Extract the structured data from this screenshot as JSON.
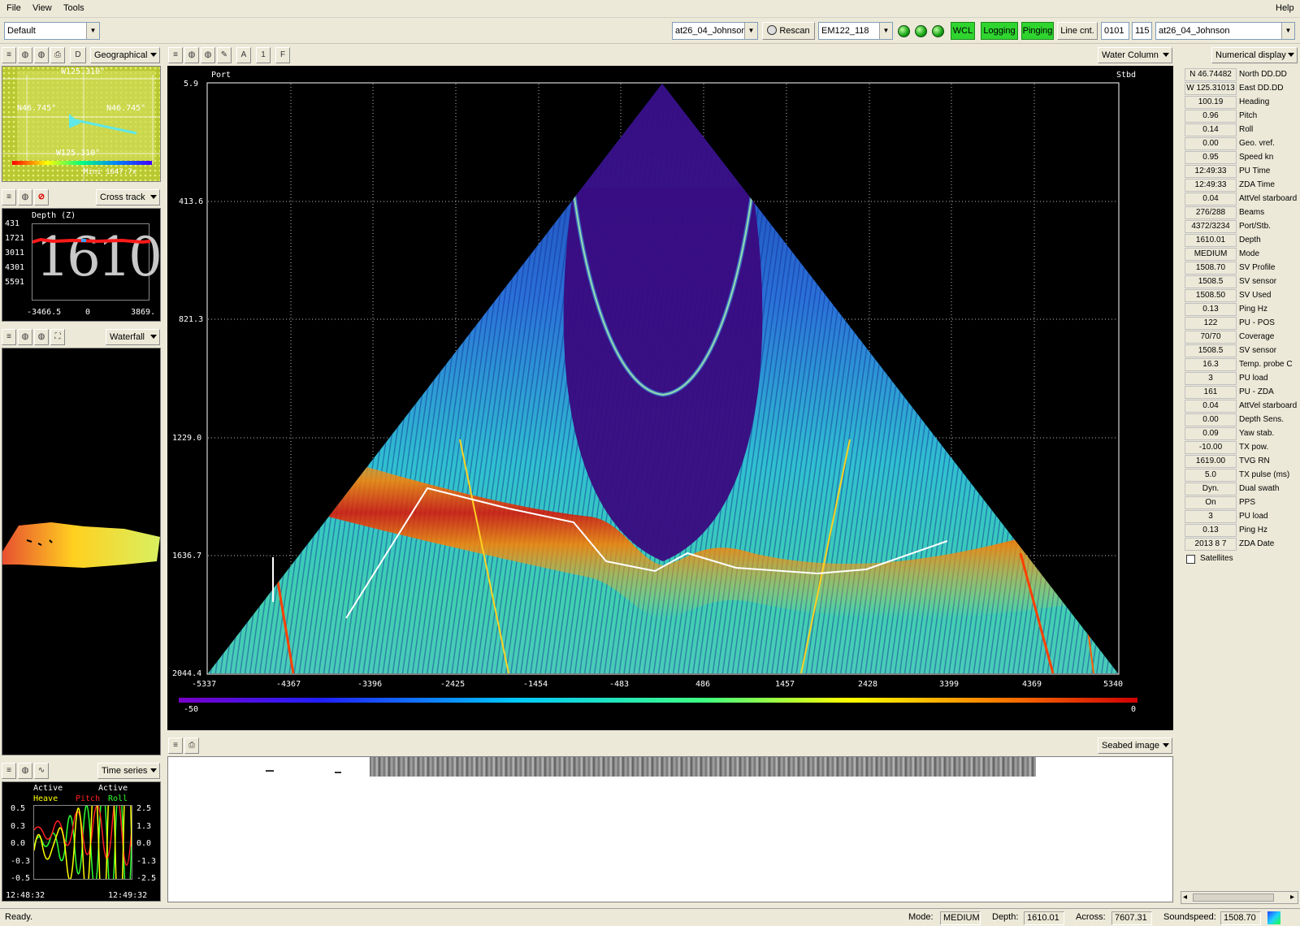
{
  "menu": {
    "file": "File",
    "view": "View",
    "tools": "Tools",
    "help": "Help"
  },
  "toolbar": {
    "profile": "Default",
    "survey": "at26_04_Johnson",
    "rescan": "Rescan",
    "sonar": "EM122_118",
    "wcl": "WCL",
    "logging": "Logging",
    "pinging": "Pinging",
    "line_cnt": "Line cnt.",
    "line_num": "0101",
    "line_num2": "115",
    "survey2": "at26_04_Johnson"
  },
  "geo": {
    "d_label": "D",
    "view": "Geographical",
    "lon_top": "W125.310°",
    "lat_left": "N46.745°",
    "lat_right": "N46.745°",
    "lon_bottom": "W125.310°",
    "scale_left": "Mini",
    "scale_right": "Mini 1647.7x"
  },
  "cross": {
    "view": "Cross track",
    "title": "Depth (Z)",
    "big_depth": "1610",
    "y_ticks": [
      "431",
      "1721",
      "3011",
      "4301",
      "5591"
    ],
    "x_ticks": [
      "-3466.5",
      "0",
      "3869."
    ]
  },
  "waterfall": {
    "view": "Waterfall"
  },
  "timeseries": {
    "view": "Time series",
    "active1": "Active",
    "active2": "Active",
    "heave": "Heave",
    "pitch": "Pitch",
    "roll": "Roll",
    "left_ticks": [
      "0.5",
      "0.3",
      "0.0",
      "-0.3",
      "-0.5"
    ],
    "right_ticks": [
      "2.5",
      "1.3",
      "0.0",
      "-1.3",
      "-2.5"
    ],
    "t_start": "12:48:32",
    "t_end": "12:49:32",
    "colors": {
      "heave": "#ffff00",
      "pitch": "#ff2020",
      "roll": "#30ff30"
    }
  },
  "wc": {
    "toolbar_a": "A",
    "toolbar_1": "1",
    "toolbar_f": "F",
    "view": "Water Column",
    "port": "Port",
    "stbd": "Stbd",
    "y_ticks": [
      "5.9",
      "413.6",
      "821.3",
      "1229.0",
      "1636.7",
      "2044.4"
    ],
    "x_ticks": [
      "-5337",
      "-4367",
      "-3396",
      "-2425",
      "-1454",
      "-483",
      "486",
      "1457",
      "2428",
      "3399",
      "4369",
      "5340"
    ],
    "scale_min": "-50",
    "scale_max": "0"
  },
  "seabed": {
    "view": "Seabed image"
  },
  "numerical": {
    "view": "Numerical display",
    "rows": [
      {
        "v": "N 46.74482",
        "l": "North DD.DD"
      },
      {
        "v": "W 125.31013",
        "l": "East DD.DD"
      },
      {
        "v": "100.19",
        "l": "Heading"
      },
      {
        "v": "0.96",
        "l": "Pitch"
      },
      {
        "v": "0.14",
        "l": "Roll"
      },
      {
        "v": "0.00",
        "l": "Geo. vref."
      },
      {
        "v": "0.95",
        "l": "Speed kn"
      },
      {
        "v": "12:49:33",
        "l": "PU Time"
      },
      {
        "v": "12:49:33",
        "l": "ZDA Time"
      },
      {
        "v": "0.04",
        "l": "AttVel starboard"
      },
      {
        "v": "276/288",
        "l": "Beams"
      },
      {
        "v": "4372/3234",
        "l": "Port/Stb."
      },
      {
        "v": "1610.01",
        "l": "Depth"
      },
      {
        "v": "MEDIUM",
        "l": "Mode"
      },
      {
        "v": "1508.70",
        "l": "SV Profile"
      },
      {
        "v": "1508.5",
        "l": "SV sensor"
      },
      {
        "v": "1508.50",
        "l": "SV Used"
      },
      {
        "v": "0.13",
        "l": "Ping Hz"
      },
      {
        "v": "122",
        "l": "PU - POS"
      },
      {
        "v": "70/70",
        "l": "Coverage"
      },
      {
        "v": "1508.5",
        "l": "SV sensor"
      },
      {
        "v": "16.3",
        "l": "Temp. probe C"
      },
      {
        "v": "3",
        "l": "PU load"
      },
      {
        "v": "161",
        "l": "PU - ZDA"
      },
      {
        "v": "0.04",
        "l": "AttVel starboard"
      },
      {
        "v": "0.00",
        "l": "Depth Sens."
      },
      {
        "v": "0.09",
        "l": "Yaw stab."
      },
      {
        "v": "-10.00",
        "l": "TX pow."
      },
      {
        "v": "1619.00",
        "l": "TVG RN"
      },
      {
        "v": "5.0",
        "l": "TX pulse (ms)"
      },
      {
        "v": "Dyn.",
        "l": "Dual swath"
      },
      {
        "v": "On",
        "l": "PPS"
      },
      {
        "v": "3",
        "l": "PU load"
      },
      {
        "v": "0.13",
        "l": "Ping Hz"
      },
      {
        "v": "2013 8 7",
        "l": "ZDA Date"
      }
    ],
    "satellites": "Satellites"
  },
  "status": {
    "ready": "Ready.",
    "mode_lbl": "Mode:",
    "mode": "MEDIUM",
    "depth_lbl": "Depth:",
    "depth": "1610.01",
    "across_lbl": "Across:",
    "across": "7607.31",
    "ss_lbl": "Soundspeed:",
    "ss": "1508.70"
  }
}
